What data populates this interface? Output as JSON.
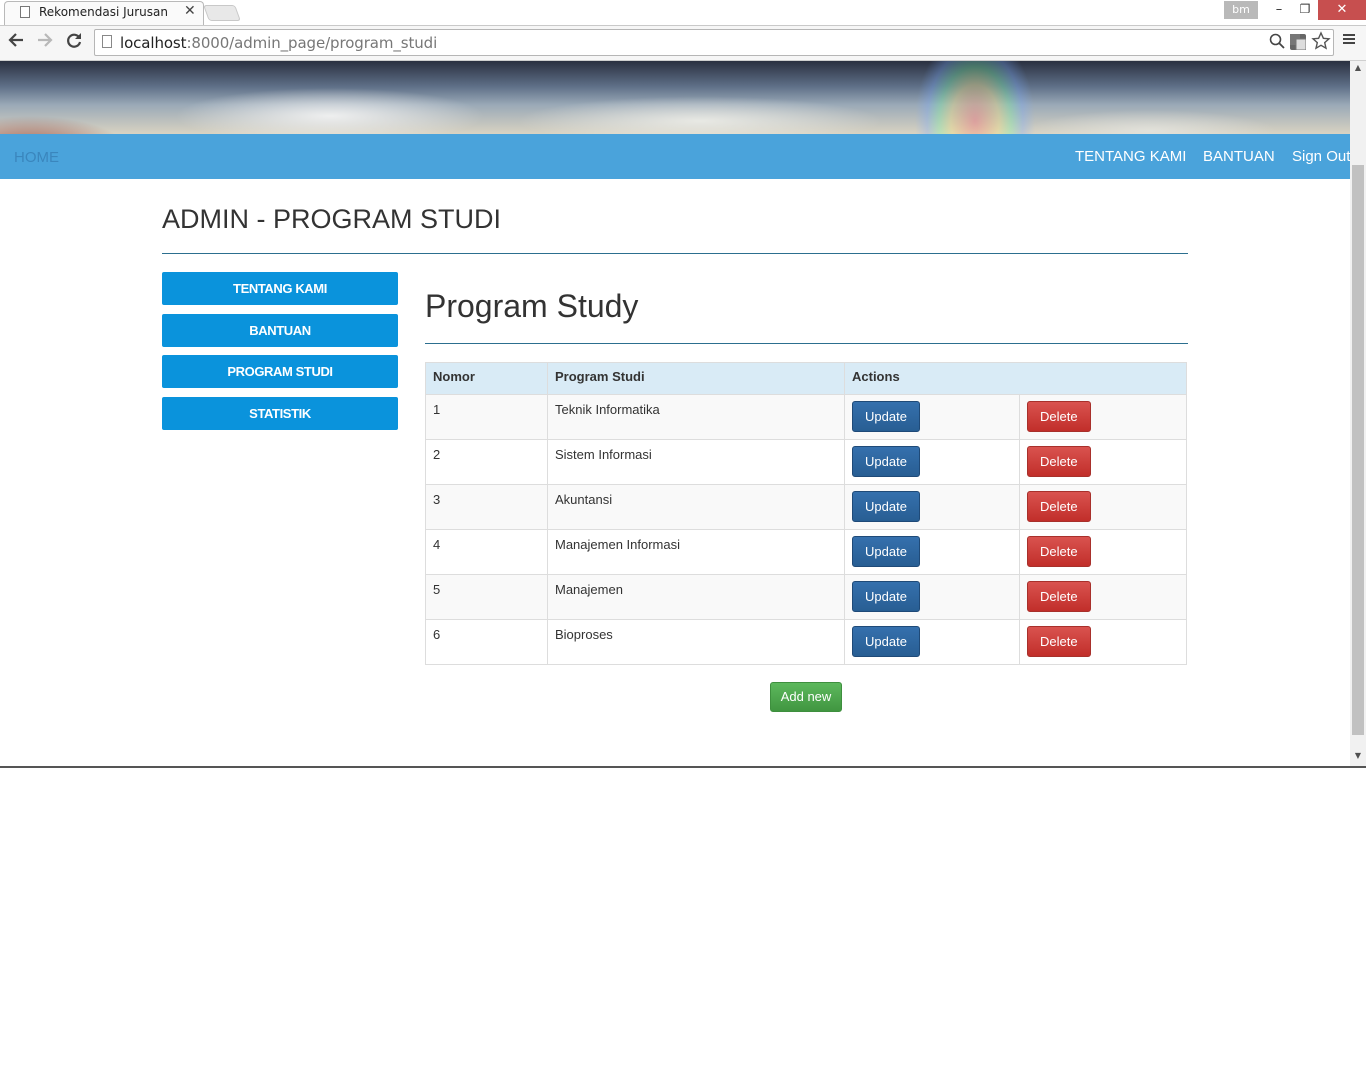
{
  "browser": {
    "tab_title": "Rekomendasi Jurusan",
    "tab_close": "✕",
    "profile_badge": "bm",
    "window_min": "–",
    "window_max": "❐",
    "window_close": "✕",
    "url_host": "localhost",
    "url_rest": ":8000/admin_page/program_studi",
    "icons": [
      "back-icon",
      "forward-icon",
      "reload-icon",
      "page-icon",
      "zoom-icon",
      "translate-icon",
      "star-icon",
      "menu-icon"
    ]
  },
  "navbar": {
    "home": "HOME",
    "tentang_kami": "TENTANG KAMI",
    "bantuan": "BANTUAN",
    "sign_out": "Sign Out",
    "color": "#4aa3db"
  },
  "page": {
    "title": "ADMIN - PROGRAM STUDI"
  },
  "sidebar": {
    "items": [
      {
        "label": "TENTANG KAMI"
      },
      {
        "label": "BANTUAN"
      },
      {
        "label": "PROGRAM STUDI"
      },
      {
        "label": "STATISTIK"
      }
    ],
    "color": "#0a93dc"
  },
  "main": {
    "heading": "Program Study",
    "columns": [
      "Nomor",
      "Program Studi",
      "Actions"
    ],
    "rows": [
      {
        "nomor": "1",
        "program": "Teknik Informatika"
      },
      {
        "nomor": "2",
        "program": "Sistem Informasi"
      },
      {
        "nomor": "3",
        "program": "Akuntansi"
      },
      {
        "nomor": "4",
        "program": "Manajemen Informasi"
      },
      {
        "nomor": "5",
        "program": "Manajemen"
      },
      {
        "nomor": "6",
        "program": "Bioproses"
      }
    ],
    "update_label": "Update",
    "delete_label": "Delete",
    "add_new_label": "Add new",
    "colors": {
      "update": "#285e93",
      "delete": "#c12e2a",
      "add_new": "#4cae4c"
    }
  }
}
